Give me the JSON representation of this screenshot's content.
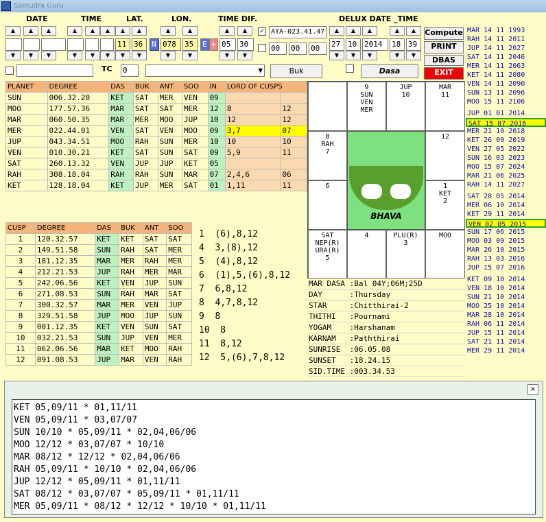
{
  "window": {
    "title": "Samudra Guru"
  },
  "headers": {
    "date": "DATE",
    "time": "TIME",
    "lat": "LAT.",
    "lon": "LON.",
    "timedif": "TIME DIF.",
    "delux": "DELUX DATE _TIME"
  },
  "inputs": {
    "lat_deg": "11",
    "lat_min": "36",
    "ns": "N",
    "lon_deg": "078",
    "lon_min": "35",
    "ew": "E",
    "plus": "+",
    "td_h": "05",
    "td_m": "30",
    "aya": "AYA-023.41.47",
    "t1": "00",
    "t2": "00",
    "t3": "00",
    "dd_day": "27",
    "dd_mon": "10",
    "dd_year": "2014",
    "dd_h": "18",
    "dd_m": "39",
    "tc_label": "TC",
    "tc_value": "0"
  },
  "buttons": {
    "compute": "Compute",
    "print": "PRINT",
    "dbas": "DBAS",
    "exit": "EXIT",
    "buk": "Buk",
    "dasa": "Dasa"
  },
  "planet_table": {
    "headers": [
      "PLANET",
      "DEGREE",
      "DAS",
      "BUK",
      "ANT",
      "SOO",
      "IN",
      "LORD OF CUSPS"
    ],
    "rows": [
      [
        "SUN",
        "006.32.20",
        "KET",
        "SAT",
        "MER",
        "VEN",
        "09",
        "",
        ""
      ],
      [
        "MOO",
        "177.57.36",
        "MAR",
        "SAT",
        "SAT",
        "MER",
        "12",
        "8",
        "12"
      ],
      [
        "MAR",
        "060.50.35",
        "MAR",
        "MER",
        "MOO",
        "JUP",
        "10",
        "12",
        "12"
      ],
      [
        "MER",
        "022.44.01",
        "VEN",
        "SAT",
        "VEN",
        "MOO",
        "09",
        "3,7",
        "07"
      ],
      [
        "JUP",
        "043.34.51",
        "MOO",
        "RAH",
        "SUN",
        "MER",
        "10",
        "10",
        "10"
      ],
      [
        "VEN",
        "010.30.21",
        "KET",
        "SAT",
        "SUN",
        "SAT",
        "09",
        "5,9",
        "11"
      ],
      [
        "SAT",
        "260.13.32",
        "VEN",
        "JUP",
        "JUP",
        "KET",
        "05",
        "",
        ""
      ],
      [
        "RAH",
        "308.18.04",
        "RAH",
        "RAH",
        "SUN",
        "MAR",
        "07",
        "2,4,6",
        "06"
      ],
      [
        "KET",
        "128.18.04",
        "KET",
        "JUP",
        "MER",
        "SAT",
        "01",
        "1,11",
        "11"
      ]
    ]
  },
  "cusp_table": {
    "headers": [
      "CUSP",
      "DEGREE",
      "DAS",
      "BUK",
      "ANT",
      "SOO"
    ],
    "rows": [
      [
        "1",
        "120.32.57",
        "KET",
        "KET",
        "SAT",
        "SAT"
      ],
      [
        "2",
        "149.51.58",
        "SUN",
        "RAH",
        "SAT",
        "MER"
      ],
      [
        "3",
        "181.12.35",
        "MAR",
        "MER",
        "RAH",
        "MER"
      ],
      [
        "4",
        "212.21.53",
        "JUP",
        "RAH",
        "MER",
        "MAR"
      ],
      [
        "5",
        "242.06.56",
        "KET",
        "VEN",
        "JUP",
        "SUN"
      ],
      [
        "6",
        "271.08.53",
        "SUN",
        "RAH",
        "MAR",
        "SAT"
      ],
      [
        "7",
        "300.32.57",
        "MAR",
        "MER",
        "VEN",
        "JUP"
      ],
      [
        "8",
        "329.51.58",
        "JUP",
        "MOO",
        "JUP",
        "SUN"
      ],
      [
        "9",
        "001.12.35",
        "KET",
        "VEN",
        "SUN",
        "SAT"
      ],
      [
        "10",
        "032.21.53",
        "SUN",
        "JUP",
        "VEN",
        "MER"
      ],
      [
        "11",
        "062.06.56",
        "MAR",
        "KET",
        "MOO",
        "RAH"
      ],
      [
        "12",
        "091.08.53",
        "JUP",
        "MAR",
        "VEN",
        "RAH"
      ]
    ],
    "significators": [
      "1  (6),8,12",
      "4  3,(8),12",
      "5  (4),8,12",
      "6  (1),5,(6),8,12",
      "7  6,8,12",
      "8  4,7,8,12",
      "9  8",
      "10  8",
      "11  8,12",
      "12  5,(6),7,8,12"
    ]
  },
  "chart": {
    "cells": {
      "c_top2": "9\nSUN\nVEN\nMER",
      "c_top3": "JUP\n10",
      "c_top4": "MAR\n11",
      "c_l2": "8\nRAH\n7",
      "c_r2": "12",
      "c_l3": "6",
      "c_r3": "1\nKET\n2",
      "c_b1": "SAT\nNEP(R)\nURA(R)\n5",
      "c_b2": "4",
      "c_b3": "PLU(R)\n3",
      "c_b4": "MOO"
    },
    "center_label": "BHAVA"
  },
  "info": [
    "MAR DASA :Bal 04Y;06M;25D",
    "DAY      :Thursday",
    "STAR     :Chitthirai-2",
    "THITHI   :Pournami",
    "YOGAM    :Harshanam",
    "KARNAM   :Paththirai",
    "SUNRISE  :06.05.08",
    "SUNSET   :18.24.15",
    "SID.TIME :003.34.53"
  ],
  "dasa_list": [
    [
      "MAR 14 11 1993"
    ],
    [
      "RAH 14 11 2011"
    ],
    [
      "JUP 14 11 2027"
    ],
    [
      "SAT 14 11 2046"
    ],
    [
      "MER 14 11 2063"
    ],
    [
      "KET 14 11 2080"
    ],
    [
      "VEN 14 11 2090"
    ],
    [
      "SUN 13 11 2096"
    ],
    [
      "MOO 15 11 2106"
    ],
    [
      "JUP 01 01 2014"
    ],
    [
      "SAT 15 07 2016"
    ],
    [
      "MER 21 10 2018"
    ],
    [
      "KET 26 09 2019"
    ],
    [
      "VEN 27 05 2022"
    ],
    [
      "SUN 16 03 2023"
    ],
    [
      "MOO 15 07 2024"
    ],
    [
      "MAR 21 06 2025"
    ],
    [
      "RAH 14 11 2027"
    ],
    [
      "SAT 28 05 2014"
    ],
    [
      "MER 06 10 2014"
    ],
    [
      "KET 29 11 2014"
    ],
    [
      "VEN 02 05 2015"
    ],
    [
      "SUN 17 06 2015"
    ],
    [
      "MOO 03 09 2015"
    ],
    [
      "MAR 26 10 2015"
    ],
    [
      "RAH 13 03 2016"
    ],
    [
      "JUP 15 07 2016"
    ],
    [
      "KET 09 10 2014"
    ],
    [
      "VEN 18 10 2014"
    ],
    [
      "SUN 21 10 2014"
    ],
    [
      "MOO 25 10 2014"
    ],
    [
      "MAR 28 10 2014"
    ],
    [
      "RAH 06 11 2014"
    ],
    [
      "JUP 15 11 2014"
    ],
    [
      "SAT 21 11 2014"
    ],
    [
      "MER 29 11 2014"
    ]
  ],
  "output_lines": [
    "KET 05,09/11 * 01,11/11",
    "VEN 05,09/11 * 03,07/07",
    "SUN 10/10 * 05,09/11 * 02,04,06/06",
    "MOO 12/12 * 03,07/07 * 10/10",
    "MAR 08/12 * 12/12 * 02,04,06/06",
    "RAH 05,09/11 * 10/10 * 02,04,06/06",
    "JUP 12/12 * 05,09/11 * 01,11/11",
    "SAT 08/12 * 03,07/07 * 05,09/11 * 01,11/11",
    "MER 05,09/11 * 08/12 * 12/12 * 10/10 * 01,11/11"
  ],
  "close_icon": "close-icon"
}
